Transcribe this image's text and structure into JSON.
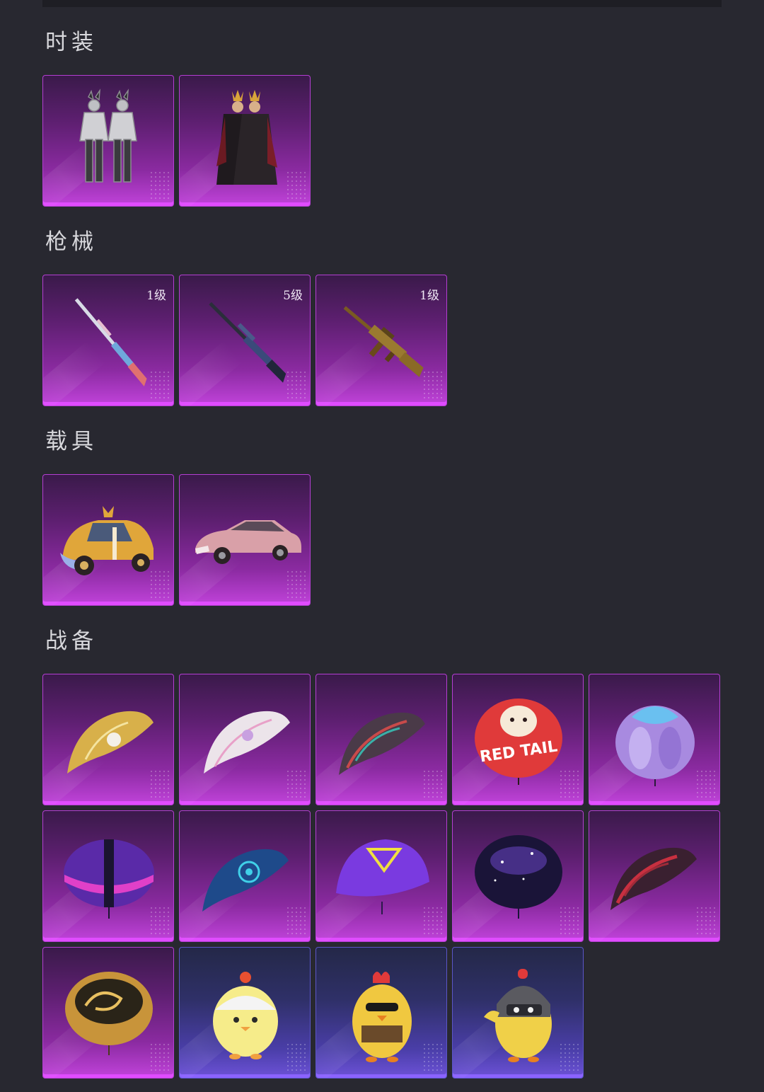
{
  "sections": {
    "outfits": {
      "title": "时装"
    },
    "weapons": {
      "title": "枪械",
      "items": [
        {
          "level": "1级"
        },
        {
          "level": "5级"
        },
        {
          "level": "1级"
        }
      ]
    },
    "vehicles": {
      "title": "载具"
    },
    "equipment": {
      "title": "战备"
    }
  },
  "icons": {
    "outfits": [
      "bunny-armor-outfit-icon",
      "golden-crown-outfit-icon"
    ],
    "weapons": [
      "rifle-skin-icon",
      "sniper-rifle-skin-icon",
      "assault-rifle-skin-icon"
    ],
    "vehicles": [
      "beetle-car-skin-icon",
      "pink-sedan-skin-icon"
    ],
    "equipment": [
      "golden-glider-icon",
      "white-glider-icon",
      "patterned-glider-icon",
      "red-tail-parachute-icon",
      "purple-crystal-parachute-icon",
      "neon-city-parachute-icon",
      "blue-glider-icon",
      "purple-triangle-parachute-icon",
      "galaxy-parachute-icon",
      "red-pattern-glider-icon",
      "golden-dragon-parachute-icon",
      "chick-pet-icon",
      "sunglasses-chicken-pet-icon",
      "helmet-chick-pet-icon"
    ]
  },
  "parachute_text": "RED TAIL",
  "colors": {
    "background": "#282830",
    "epic_purple": "#c143db",
    "rare_blue": "#6d52d8",
    "title_text": "#d8d8dc"
  }
}
